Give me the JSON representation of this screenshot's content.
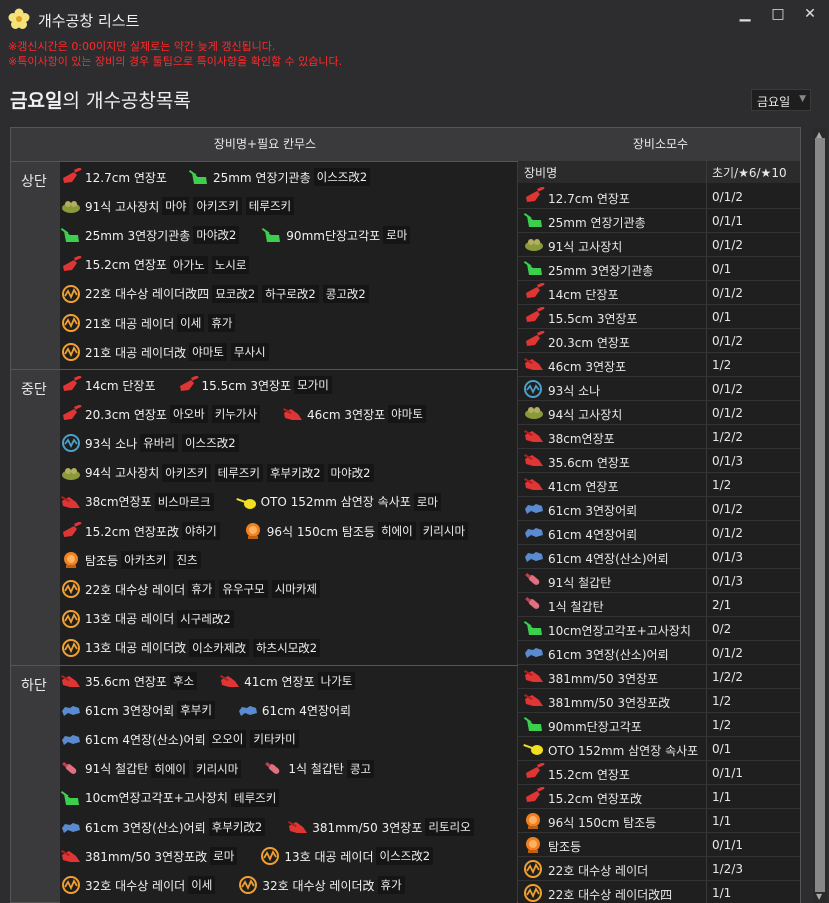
{
  "window": {
    "title": "개수공창 리스트",
    "minimize": "▁",
    "maximize": "□",
    "close": "✕"
  },
  "notices": [
    "※갱신시간은 0:00이지만 실제로는 약간 늦게 갱신됩니다.",
    "※특이사항이 있는 장비의 경우 툴팁으로 특이사항을 확인할 수 있습니다."
  ],
  "heading": {
    "day": "금요일",
    "rest": "의 개수공창목록"
  },
  "day_select": {
    "value": "금요일"
  },
  "left_header": "장비명+필요 칸무스",
  "right_header": "장비소모수",
  "colors": {
    "red_gun": "#e03535",
    "green_aa": "#3ccf4e",
    "olive": "#8a9a3a",
    "radar": "#f0a030",
    "sonar": "#4aa0c8",
    "torpedo": "#5a8ad0",
    "shell": "#e07080",
    "yellow": "#f0e020",
    "orange": "#f08020"
  },
  "sections": [
    {
      "label": "상단",
      "rows": [
        [
          {
            "icon": "red_gun",
            "name": "12.7cm 연장포",
            "ships": []
          },
          {
            "icon": "green_aa",
            "name": "25mm 연장기관총",
            "ships": [
              "이스즈改2"
            ]
          }
        ],
        [
          {
            "icon": "olive",
            "name": "91식 고사장치",
            "ships": [
              "마야",
              "아키즈키",
              "테루즈키"
            ]
          }
        ],
        [
          {
            "icon": "green_aa",
            "name": "25mm 3연장기관총",
            "ships": [
              "마야改2"
            ]
          },
          {
            "icon": "green_aa",
            "name": "90mm단장고각포",
            "ships": [
              "로마"
            ]
          }
        ],
        [
          {
            "icon": "red_gun",
            "name": "15.2cm 연장포",
            "ships": [
              "아가노",
              "노시로"
            ]
          }
        ],
        [
          {
            "icon": "radar",
            "name": "22호 대수상 레이더改四",
            "ships": [
              "묘코改2",
              "하구로改2",
              "콩고改2"
            ]
          }
        ],
        [
          {
            "icon": "radar",
            "name": "21호 대공 레이더",
            "ships": [
              "이세",
              "휴가"
            ]
          }
        ],
        [
          {
            "icon": "radar",
            "name": "21호 대공 레이더改",
            "ships": [
              "야마토",
              "무사시"
            ]
          }
        ]
      ]
    },
    {
      "label": "중단",
      "rows": [
        [
          {
            "icon": "red_gun",
            "name": "14cm 단장포",
            "ships": []
          },
          {
            "icon": "red_gun",
            "name": "15.5cm 3연장포",
            "ships": [
              "모가미"
            ]
          }
        ],
        [
          {
            "icon": "red_gun",
            "name": "20.3cm 연장포",
            "ships": [
              "아오바",
              "키누가사"
            ]
          },
          {
            "icon": "red_big",
            "name": "46cm 3연장포",
            "ships": [
              "야마토"
            ]
          }
        ],
        [
          {
            "icon": "sonar",
            "name": "93식 소나",
            "ships": [
              "유바리",
              "이스즈改2"
            ]
          }
        ],
        [
          {
            "icon": "olive",
            "name": "94식 고사장치",
            "ships": [
              "아키즈키",
              "테루즈키",
              "후부키改2",
              "마야改2"
            ]
          }
        ],
        [
          {
            "icon": "red_big",
            "name": "38cm연장포",
            "ships": [
              "비스마르크"
            ]
          },
          {
            "icon": "yellow",
            "name": "OTO 152mm 삼연장 속사포",
            "ships": [
              "로마"
            ]
          }
        ],
        [
          {
            "icon": "red_gun",
            "name": "15.2cm 연장포改",
            "ships": [
              "야하기"
            ]
          },
          {
            "icon": "orange",
            "name": "96식 150cm 탐조등",
            "ships": [
              "히에이",
              "키리시마"
            ]
          }
        ],
        [
          {
            "icon": "orange",
            "name": "탐조등",
            "ships": [
              "아카츠키",
              "진츠"
            ]
          }
        ],
        [
          {
            "icon": "radar",
            "name": "22호 대수상 레이더",
            "ships": [
              "휴가",
              "유우구모",
              "시마카제"
            ]
          }
        ],
        [
          {
            "icon": "radar",
            "name": "13호 대공 레이더",
            "ships": [
              "시구레改2"
            ]
          }
        ],
        [
          {
            "icon": "radar",
            "name": "13호 대공 레이더改",
            "ships": [
              "이소카제改",
              "하츠시모改2"
            ]
          }
        ]
      ]
    },
    {
      "label": "하단",
      "rows": [
        [
          {
            "icon": "red_big",
            "name": "35.6cm 연장포",
            "ships": [
              "후소"
            ]
          },
          {
            "icon": "red_big",
            "name": "41cm 연장포",
            "ships": [
              "나가토"
            ]
          }
        ],
        [
          {
            "icon": "torpedo",
            "name": "61cm 3연장어뢰",
            "ships": [
              "후부키"
            ]
          },
          {
            "icon": "torpedo",
            "name": "61cm 4연장어뢰",
            "ships": []
          }
        ],
        [
          {
            "icon": "torpedo",
            "name": "61cm 4연장(산소)어뢰",
            "ships": [
              "오오이",
              "키타카미"
            ]
          }
        ],
        [
          {
            "icon": "shell",
            "name": "91식 철갑탄",
            "ships": [
              "히에이",
              "키리시마"
            ]
          },
          {
            "icon": "shell",
            "name": "1식 철갑탄",
            "ships": [
              "콩고"
            ]
          }
        ],
        [
          {
            "icon": "green_aa",
            "name": "10cm연장고각포+고사장치",
            "ships": [
              "테루즈키"
            ]
          }
        ],
        [
          {
            "icon": "torpedo",
            "name": "61cm 3연장(산소)어뢰",
            "ships": [
              "후부키改2"
            ]
          },
          {
            "icon": "red_big",
            "name": "381mm/50 3연장포",
            "ships": [
              "리토리오"
            ]
          }
        ],
        [
          {
            "icon": "red_big",
            "name": "381mm/50 3연장포改",
            "ships": [
              "로마"
            ]
          },
          {
            "icon": "radar",
            "name": "13호 대공 레이더",
            "ships": [
              "이스즈改2"
            ]
          }
        ],
        [
          {
            "icon": "radar",
            "name": "32호 대수상 레이더",
            "ships": [
              "이세"
            ]
          },
          {
            "icon": "radar",
            "name": "32호 대수상 레이더改",
            "ships": [
              "휴가"
            ]
          }
        ]
      ]
    }
  ],
  "table": {
    "col_name": "장비명",
    "col_count": "초기/★6/★10",
    "rows": [
      {
        "icon": "red_gun",
        "name": "12.7cm 연장포",
        "count": "0/1/2"
      },
      {
        "icon": "green_aa",
        "name": "25mm 연장기관총",
        "count": "0/1/1"
      },
      {
        "icon": "olive",
        "name": "91식 고사장치",
        "count": "0/1/2"
      },
      {
        "icon": "green_aa",
        "name": "25mm 3연장기관총",
        "count": "0/1"
      },
      {
        "icon": "red_gun",
        "name": "14cm 단장포",
        "count": "0/1/2"
      },
      {
        "icon": "red_gun",
        "name": "15.5cm 3연장포",
        "count": "0/1"
      },
      {
        "icon": "red_gun",
        "name": "20.3cm 연장포",
        "count": "0/1/2"
      },
      {
        "icon": "red_big",
        "name": "46cm 3연장포",
        "count": "1/2"
      },
      {
        "icon": "sonar",
        "name": "93식 소나",
        "count": "0/1/2"
      },
      {
        "icon": "olive",
        "name": "94식 고사장치",
        "count": "0/1/2"
      },
      {
        "icon": "red_big",
        "name": "38cm연장포",
        "count": "1/2/2"
      },
      {
        "icon": "red_big",
        "name": "35.6cm 연장포",
        "count": "0/1/3"
      },
      {
        "icon": "red_big",
        "name": "41cm 연장포",
        "count": "1/2"
      },
      {
        "icon": "torpedo",
        "name": "61cm 3연장어뢰",
        "count": "0/1/2"
      },
      {
        "icon": "torpedo",
        "name": "61cm 4연장어뢰",
        "count": "0/1/2"
      },
      {
        "icon": "torpedo",
        "name": "61cm 4연장(산소)어뢰",
        "count": "0/1/3"
      },
      {
        "icon": "shell",
        "name": "91식 철갑탄",
        "count": "0/1/3"
      },
      {
        "icon": "shell",
        "name": "1식 철갑탄",
        "count": "2/1"
      },
      {
        "icon": "green_aa",
        "name": "10cm연장고각포+고사장치",
        "count": "0/2"
      },
      {
        "icon": "torpedo",
        "name": "61cm 3연장(산소)어뢰",
        "count": "0/1/2"
      },
      {
        "icon": "red_big",
        "name": "381mm/50 3연장포",
        "count": "1/2/2"
      },
      {
        "icon": "red_big",
        "name": "381mm/50 3연장포改",
        "count": "1/2"
      },
      {
        "icon": "green_aa",
        "name": "90mm단장고각포",
        "count": "1/2"
      },
      {
        "icon": "yellow",
        "name": "OTO 152mm 삼연장 속사포",
        "count": "0/1"
      },
      {
        "icon": "red_gun",
        "name": "15.2cm 연장포",
        "count": "0/1/1"
      },
      {
        "icon": "red_gun",
        "name": "15.2cm 연장포改",
        "count": "1/1"
      },
      {
        "icon": "orange",
        "name": "96식 150cm 탐조등",
        "count": "1/1"
      },
      {
        "icon": "orange",
        "name": "탐조등",
        "count": "0/1/1"
      },
      {
        "icon": "radar",
        "name": "22호 대수상 레이더",
        "count": "1/2/3"
      },
      {
        "icon": "radar",
        "name": "22호 대수상 레이더改四",
        "count": "1/1"
      }
    ]
  }
}
